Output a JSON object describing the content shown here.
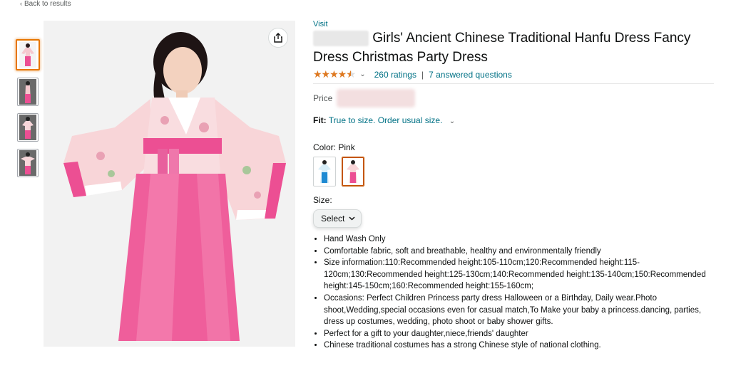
{
  "nav": {
    "back_label": "Back to results"
  },
  "product": {
    "visit_label": "Visit",
    "title_suffix": "Girls' Ancient Chinese Traditional Hanfu Dress Fancy Dress Christmas Party Dress",
    "rating_stars": 4.5,
    "ratings_label": "260 ratings",
    "questions_label": "7 answered questions",
    "price_label": "Price",
    "fit_label": "Fit:",
    "fit_value": "True to size. Order usual size.",
    "color_label": "Color:",
    "color_value": "Pink",
    "size_label": "Size:",
    "size_select_value": "Select",
    "bullets": [
      "Hand Wash Only",
      "Comfortable fabric, soft and breathable, healthy and environmentally friendly",
      "Size information:110:Recommended height:105-110cm;120:Recommended height:115-120cm;130:Recommended height:125-130cm;140:Recommended height:135-140cm;150:Recommended height:145-150cm;160:Recommended height:155-160cm;",
      "Occasions: Perfect Children Princess party dress Halloween or a Birthday, Daily wear.Photo shoot,Wedding,special occasions even for casual match,To Make your baby a princess.dancing, parties, dress up costumes, wedding, photo shoot or baby shower gifts.",
      "Perfect for a gift to your daughter,niece,friends' daughter",
      "Chinese traditional costumes has a strong Chinese style of national clothing."
    ]
  },
  "colors": {
    "accent": "#007185",
    "star": "#de7921",
    "selected": "#e77600",
    "dress_pink": "#ec4f93"
  }
}
